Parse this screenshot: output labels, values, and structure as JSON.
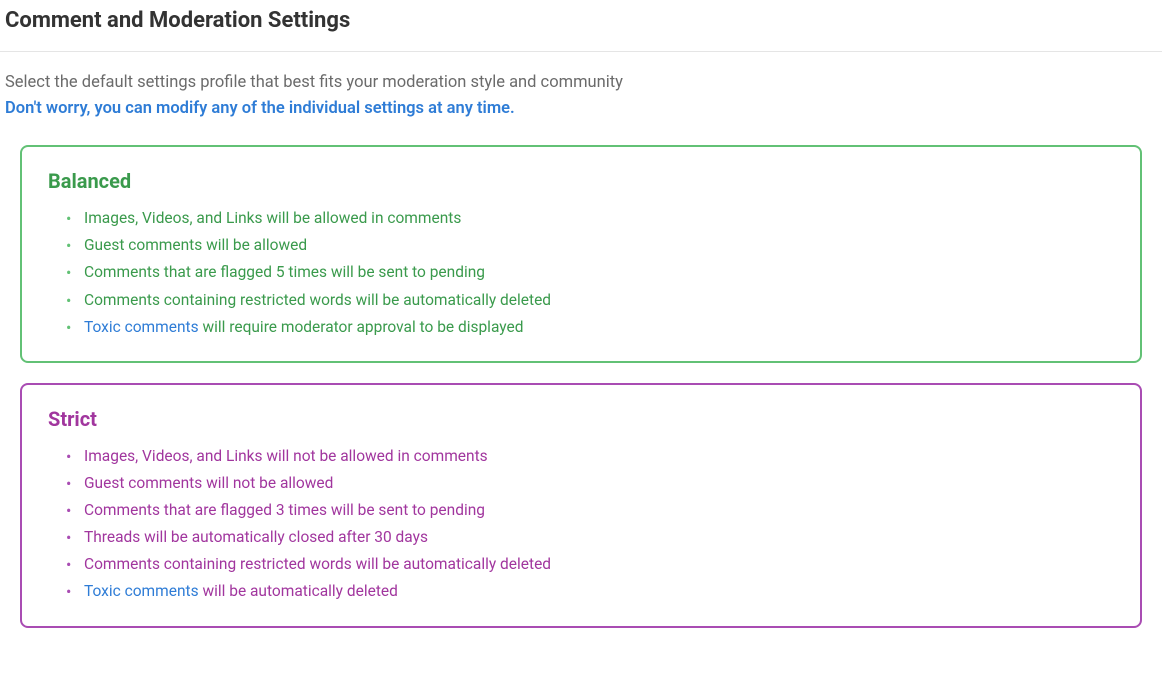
{
  "header": {
    "title": "Comment and Moderation Settings"
  },
  "intro": {
    "line1": "Select the default settings profile that best fits your moderation style and community",
    "line2": "Don't worry, you can modify any of the individual settings at any time."
  },
  "profiles": {
    "balanced": {
      "title": "Balanced",
      "items": [
        {
          "text": "Images, Videos, and Links will be allowed in comments"
        },
        {
          "text": "Guest comments will be allowed"
        },
        {
          "text": "Comments that are flagged 5 times will be sent to pending"
        },
        {
          "text": "Comments containing restricted words will be automatically deleted"
        },
        {
          "link": "Toxic comments",
          "rest": " will require moderator approval to be displayed"
        }
      ]
    },
    "strict": {
      "title": "Strict",
      "items": [
        {
          "text": "Images, Videos, and Links will not be allowed in comments"
        },
        {
          "text": "Guest comments will not be allowed"
        },
        {
          "text": "Comments that are flagged 3 times will be sent to pending"
        },
        {
          "text": "Threads will be automatically closed after 30 days"
        },
        {
          "text": "Comments containing restricted words will be automatically deleted"
        },
        {
          "link": "Toxic comments",
          "rest": " will be automatically deleted"
        }
      ]
    }
  }
}
